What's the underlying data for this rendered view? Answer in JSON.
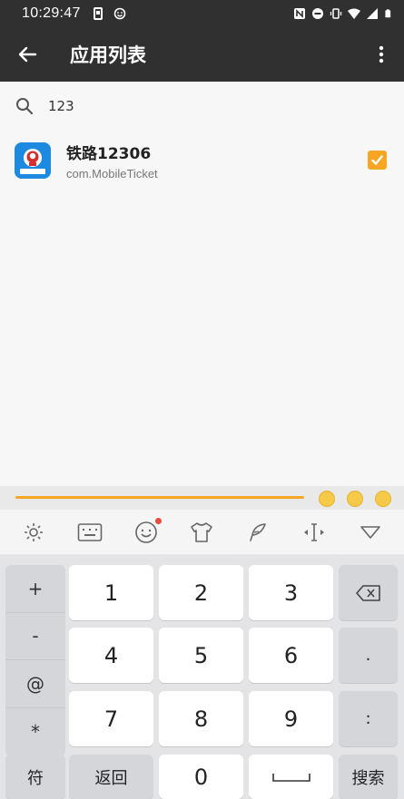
{
  "status": {
    "time": "10:29:47"
  },
  "appbar": {
    "title": "应用列表"
  },
  "search": {
    "value": "123"
  },
  "list": {
    "items": [
      {
        "name": "铁路12306",
        "package": "com.MobileTicket",
        "checked": true
      }
    ]
  },
  "keyboard": {
    "symbols": [
      "+",
      "-",
      "@",
      "*"
    ],
    "digits": [
      "1",
      "2",
      "3",
      "4",
      "5",
      "6",
      "7",
      "8",
      "9",
      "0"
    ],
    "right_keys": [
      ".",
      ":"
    ],
    "bottom": {
      "sym": "符",
      "back": "返回",
      "search": "搜索"
    }
  }
}
